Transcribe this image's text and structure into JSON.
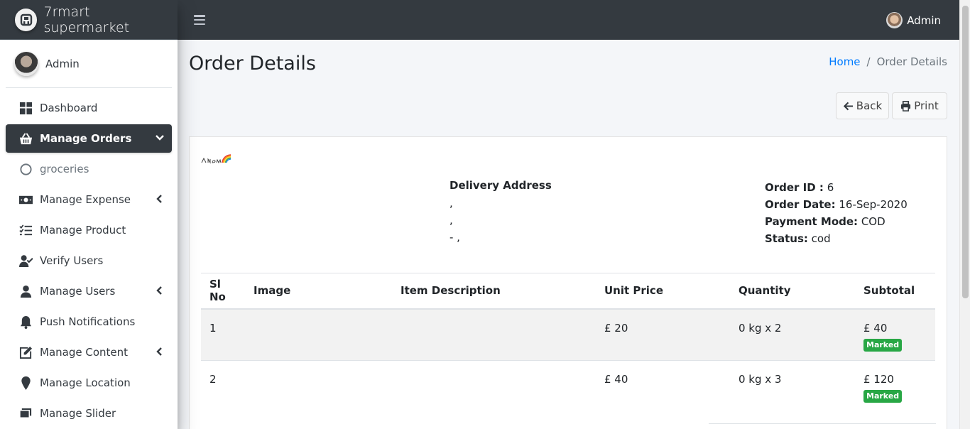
{
  "brand": {
    "name": "7rmart supermarket"
  },
  "sidebar": {
    "user_name": "Admin",
    "items": [
      {
        "label": "Dashboard",
        "icon": "dashboard-icon",
        "active": false,
        "caret": ""
      },
      {
        "label": "Manage Orders",
        "icon": "basket-icon",
        "active": true,
        "caret": "chevron-down-icon"
      },
      {
        "label": "groceries",
        "icon": "circle-icon",
        "active": false,
        "caret": "",
        "sub": true
      },
      {
        "label": "Manage Expense",
        "icon": "money-bill-icon",
        "active": false,
        "caret": "chevron-left-icon"
      },
      {
        "label": "Manage Product",
        "icon": "tasks-icon",
        "active": false,
        "caret": ""
      },
      {
        "label": "Verify Users",
        "icon": "user-check-icon",
        "active": false,
        "caret": ""
      },
      {
        "label": "Manage Users",
        "icon": "user-icon",
        "active": false,
        "caret": "chevron-left-icon"
      },
      {
        "label": "Push Notifications",
        "icon": "bell-icon",
        "active": false,
        "caret": ""
      },
      {
        "label": "Manage Content",
        "icon": "edit-icon",
        "active": false,
        "caret": "chevron-left-icon"
      },
      {
        "label": "Manage Location",
        "icon": "map-marker-icon",
        "active": false,
        "caret": ""
      },
      {
        "label": "Manage Slider",
        "icon": "slider-icon",
        "active": false,
        "caret": ""
      }
    ]
  },
  "topbar": {
    "user_name": "Admin"
  },
  "page": {
    "title": "Order Details",
    "breadcrumb": {
      "home": "Home",
      "separator": "/",
      "current": "Order Details"
    },
    "back_label": "Back",
    "print_label": "Print"
  },
  "order": {
    "delivery_title": "Delivery Address",
    "address_lines": [
      ",",
      ",",
      "- ,"
    ],
    "id_label": "Order ID :",
    "id_value": "6",
    "date_label": "Order Date:",
    "date_value": "16-Sep-2020",
    "payment_label": "Payment Mode:",
    "payment_value": "COD",
    "status_label": "Status:",
    "status_value": "cod"
  },
  "table": {
    "headers": [
      "Sl No",
      "Image",
      "Item Description",
      "Unit Price",
      "Quantity",
      "Subtotal"
    ],
    "rows": [
      {
        "sl": "1",
        "image": "",
        "description": "",
        "unit_price": "£ 20",
        "quantity": "0 kg x 2",
        "subtotal": "£ 40",
        "badge": "Marked"
      },
      {
        "sl": "2",
        "image": "",
        "description": "",
        "unit_price": "£ 40",
        "quantity": "0 kg x 3",
        "subtotal": "£ 120",
        "badge": "Marked"
      }
    ]
  },
  "colors": {
    "dark": "#343a40",
    "link": "#007bff",
    "badge": "#28a745",
    "content_bg": "#f4f6f9"
  }
}
